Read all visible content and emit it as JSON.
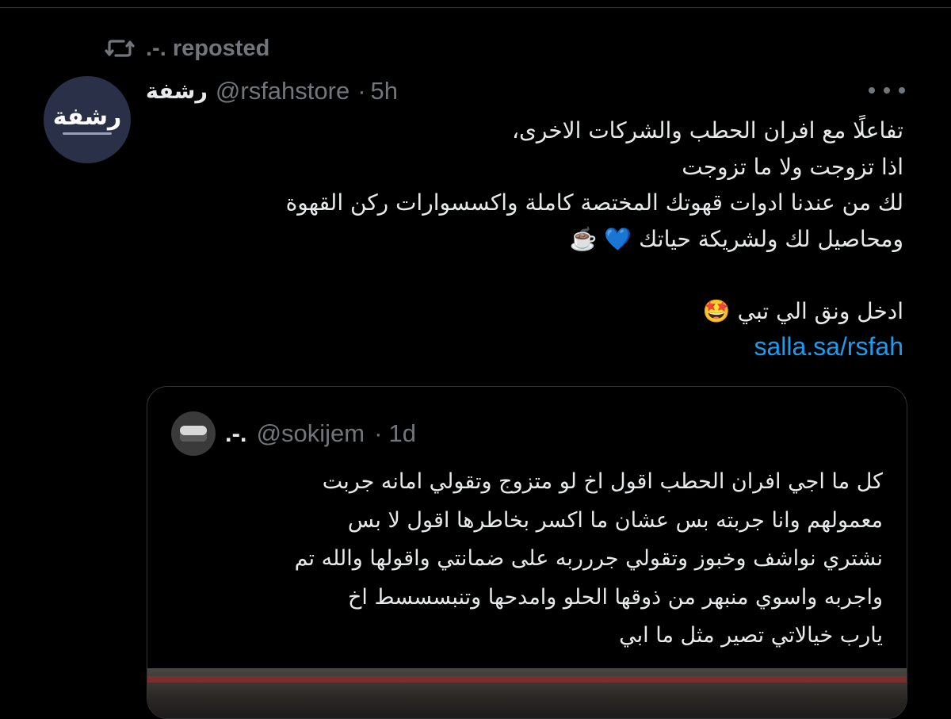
{
  "repost": {
    "icon": "repost-icon",
    "text": ".-. reposted"
  },
  "tweet": {
    "author_name": "رشفة",
    "avatar_label": "رشفة",
    "handle": "@rsfahstore",
    "separator": "·",
    "time": "5h",
    "more_icon": "more-icon",
    "lines": [
      "تفاعلًا مع افران الحطب والشركات الاخرى،",
      "اذا تزوجت ولا ما تزوجت",
      "لك من عندنا ادوات قهوتك المختصة كاملة واكسسوارات ركن القهوة",
      "ومحاصيل لك ولشريكة حياتك 💙 ☕️",
      "ادخل ونق الي تبي 🤩"
    ],
    "link": "salla.sa/rsfah"
  },
  "quote": {
    "author_name": ".-.",
    "handle": "@sokijem",
    "separator": "·",
    "time": "1d",
    "lines": [
      "كل ما اجي افران الحطب اقول اخ لو متزوج وتقولي امانه جربت",
      "معمولهم وانا جربته بس عشان ما اكسر بخاطرها اقول لا بس",
      "نشتري نواشف وخبوز وتقولي جررربه على ضمانتي واقولها والله تم",
      "واجربه واسوي منبهر من ذوقها الحلو وامدحها وتنبسسسط اخ",
      "يارب خيالاتي تصير مثل ما ابي"
    ]
  },
  "colors": {
    "background": "#000000",
    "text": "#e7e9ea",
    "muted": "#71767b",
    "link": "#1d9bf0",
    "border": "#2f3336"
  }
}
